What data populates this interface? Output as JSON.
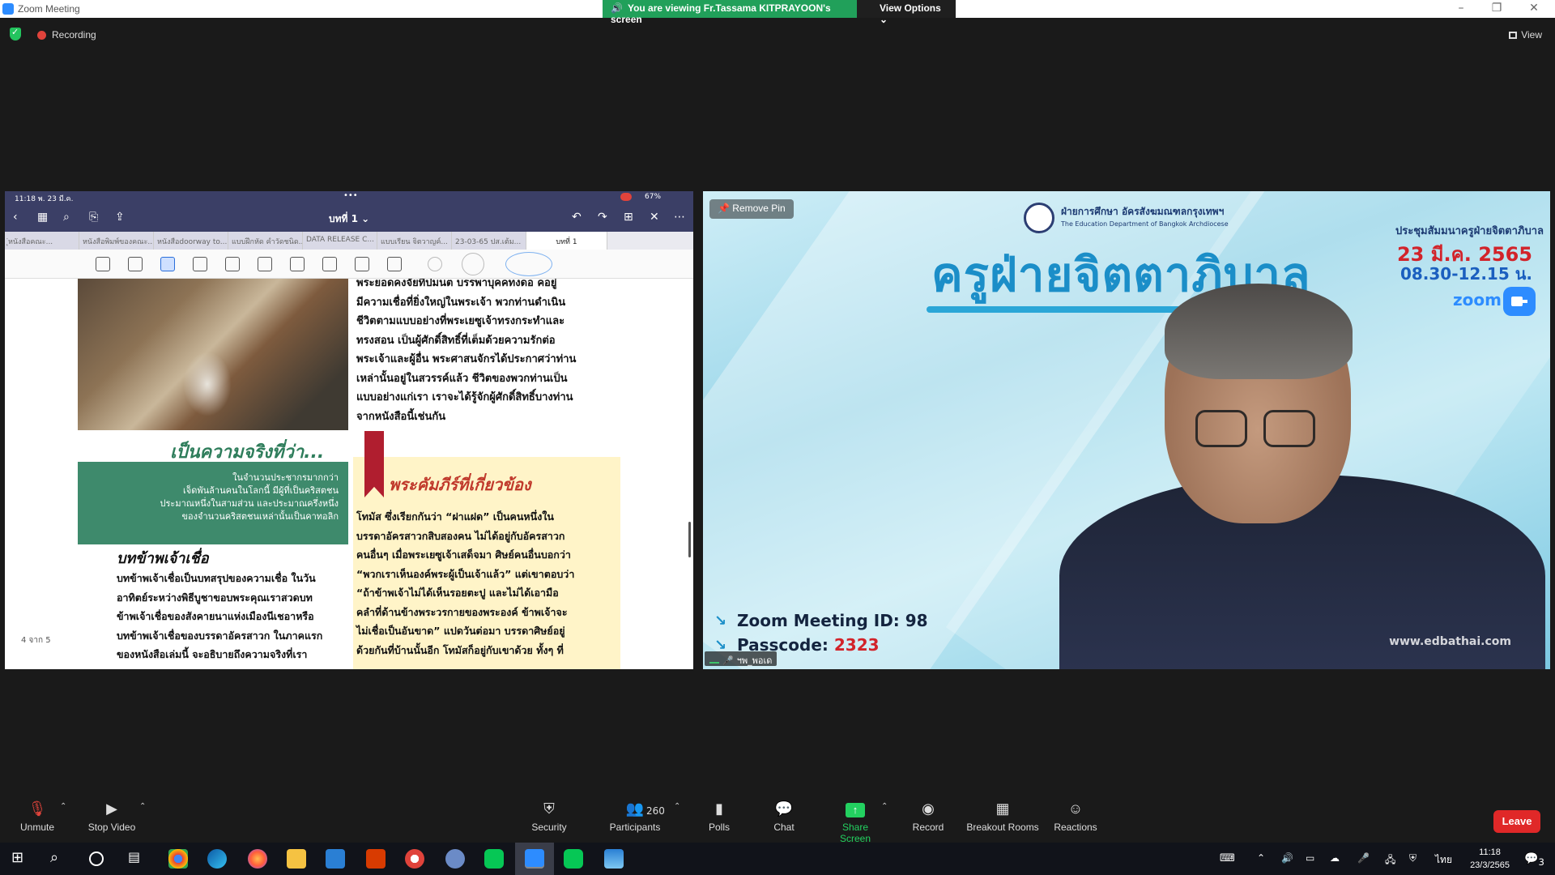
{
  "titlebar": {
    "app_title": "Zoom Meeting",
    "min": "–",
    "restore": "❐",
    "close": "✕"
  },
  "share_banner": {
    "viewing": "You are viewing Fr.Tassama KITPRAYOON's screen",
    "view_options": "View Options ⌄"
  },
  "status": {
    "recording": "Recording",
    "view": "View"
  },
  "shared_screen": {
    "ipad_time": "11:18  พ. 23 มี.ค.",
    "ipad_battery": "67%",
    "doc_title": "บทที่ 1 ⌄",
    "tabs": [
      "ุ่หนังสือคณะ...",
      "หนังสือพิมพ์ของคณะ...",
      "หนังสือdoorway to...",
      "แบบฝึกหัด คำวัดชนิด...",
      "DATA RELEASE C...",
      "แบบเรียน จิตวาญค์...",
      "23-03-65 ปส.เต้ม...",
      "บทที่ 1"
    ],
    "body_right_top": "พระยอดคงจัยที่ปมนต บรรพาบุคคทงดอ คอยู่\nมีความเชื่อที่ยิ่งใหญ่ในพระเจ้า พวกท่านดำเนิน\nชีวิตตามแบบอย่างที่พระเยซูเจ้าทรงกระทำและ\nทรงสอน เป็นผู้ศักดิ์สิทธิ์ที่เต็มด้วยความรักต่อ\nพระเจ้าและผู้อื่น พระศาสนจักรได้ประกาศว่าท่าน\nเหล่านั้นอยู่ในสวรรค์แล้ว ชีวิตของพวกท่านเป็น\nแบบอย่างแก่เรา เราจะได้รู้จักผู้ศักดิ์สิทธิ์บางท่าน\nจากหนังสือนี้เช่นกัน",
    "green_head": "เป็นความจริงที่ว่า...",
    "green_box": "ในจำนวนประชากรมากกว่า\nเจ็ดพันล้านคนในโลกนี้ มีผู้ที่เป็นคริสตชน\nประมาณหนึ่งในสามส่วน และประมาณครึ่งหนึ่ง\nของจำนวนคริสตชนเหล่านั้นเป็นคาทอลิก",
    "red_head": "พระคัมภีร์ที่เกี่ยวข้อง",
    "body_right_bottom": "โทมัส ซึ่งเรียกกันว่า “ฝาแฝด” เป็นคนหนึ่งใน\nบรรดาอัครสาวกสิบสองคน ไม่ได้อยู่กับอัครสาวก\nคนอื่นๆ เมื่อพระเยซูเจ้าเสด็จมา ศิษย์คนอื่นบอกว่า\n“พวกเราเห็นองค์พระผู้เป็นเจ้าแล้ว” แต่เขาตอบว่า\n“ถ้าข้าพเจ้าไม่ได้เห็นรอยตะปู และไม่ได้เอามือ\nคลำที่ด้านข้างพระวรกายของพระองค์ ข้าพเจ้าจะ\nไม่เชื่อเป็นอันขาด” แปดวันต่อมา บรรดาศิษย์อยู่\nด้วยกันที่บ้านนั้นอีก โทมัสก็อยู่กับเขาด้วย ทั้งๆ ที่",
    "sub_head": "บทข้าพเจ้าเชื่อ",
    "body_left_bottom": "บทข้าพเจ้าเชื่อเป็นบทสรุปของความเชื่อ ในวัน\nอาทิตย์ระหว่างพิธีบูชาขอบพระคุณเราสวดบท\nข้าพเจ้าเชื่อของสังคายนาแห่งเมืองนีเชอาหรือ\nบทข้าพเจ้าเชื่อของบรรดาอัครสาวก ในภาคแรก\nของหนังสือเล่มนี้ จะอธิบายถึงความจริงที่เรา",
    "page_no": "4 จาก 5"
  },
  "video": {
    "remove_pin": "Remove Pin",
    "dept_th": "ฝ่ายการศึกษา อัครสังฆมณฑลกรุงเทพฯ",
    "dept_en": "The Education Department of Bangkok Archdiocese",
    "title": "ครูฝ่ายจิตตาภิบาล",
    "meeting_label": "ประชุมสัมมนาครูฝ่ายจิตตาภิบาล",
    "date": "23 มี.ค. 2565",
    "time": "08.30-12.15 น.",
    "zoom_word": "zoom",
    "meeting_id": "Zoom Meeting ID: 98",
    "passcode_label": "Passcode: ",
    "passcode": "2323",
    "website": "www.edbathai.com",
    "name_tag": "ฯพ_พอเด"
  },
  "toolbar": {
    "unmute": "Unmute",
    "stop_video": "Stop Video",
    "security": "Security",
    "participants": "Participants",
    "participant_count": "260",
    "polls": "Polls",
    "chat": "Chat",
    "share_screen": "Share Screen",
    "record": "Record",
    "breakout": "Breakout Rooms",
    "reactions": "Reactions",
    "leave": "Leave"
  },
  "taskbar": {
    "ime": "ไทย",
    "time": "11:18",
    "date": "23/3/2565",
    "notif_count": "3"
  },
  "colors": {
    "zoom_blue": "#2d8cff",
    "banner_green": "#21a05a",
    "leave_red": "#e02828",
    "share_green": "#23d160"
  }
}
